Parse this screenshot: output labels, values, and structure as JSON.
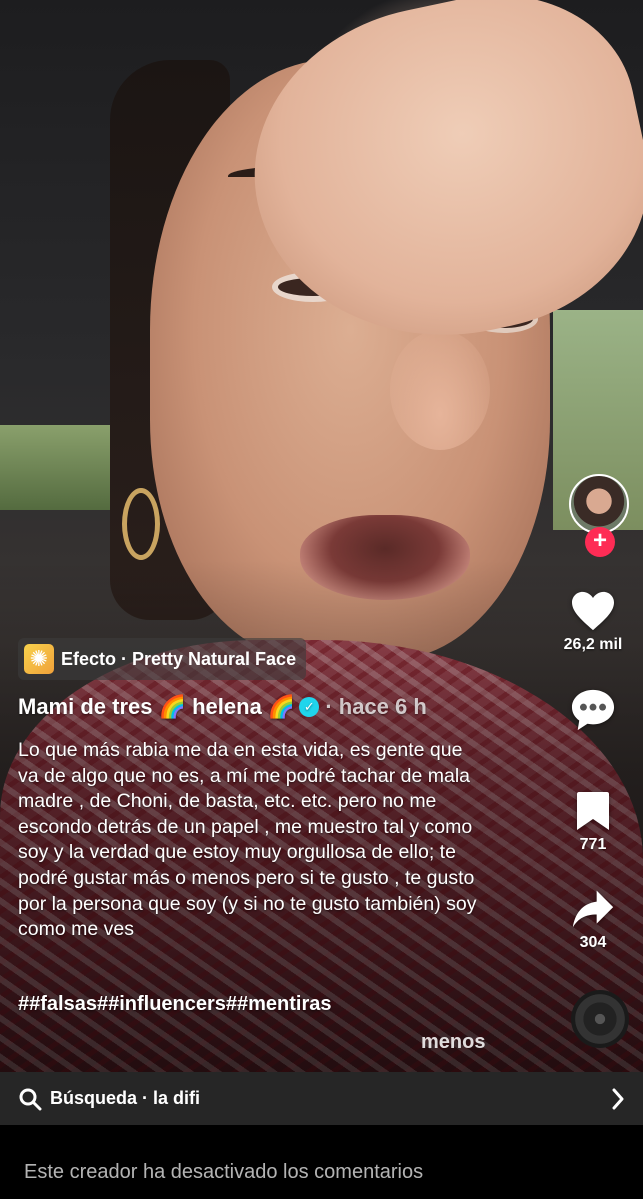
{
  "effect": {
    "prefix": "Efecto",
    "separator": "·",
    "name": "Pretty Natural Face"
  },
  "author": {
    "name": "Mami de tres 🌈 helena 🌈",
    "verified_mark": "✓",
    "time": "· hace 6 h"
  },
  "caption": {
    "text": "Lo que más rabia me da en esta vida, es gente que va de algo que no es, a mí me podré tachar de mala madre , de Choni, de basta, etc. etc.  pero no me escondo detrás de un papel , me muestro tal y como soy y la verdad que estoy muy orgullosa de ello; te podré gustar más o menos pero si te gusto , te gusto por la persona que soy (y si no te gusto también) soy como me ves",
    "hashtags": "##falsas##influencers##mentiras",
    "less_label": "menos"
  },
  "rail": {
    "likes": "26,2 mil",
    "comments": "",
    "saves": "771",
    "shares": "304"
  },
  "search": {
    "label": "Búsqueda · la difi"
  },
  "footer": {
    "comments_disabled": "Este creador ha desactivado los comentarios"
  },
  "colors": {
    "follow": "#fe2c55",
    "verified": "#20d5ec",
    "effect_icon": "#f8d24c"
  }
}
